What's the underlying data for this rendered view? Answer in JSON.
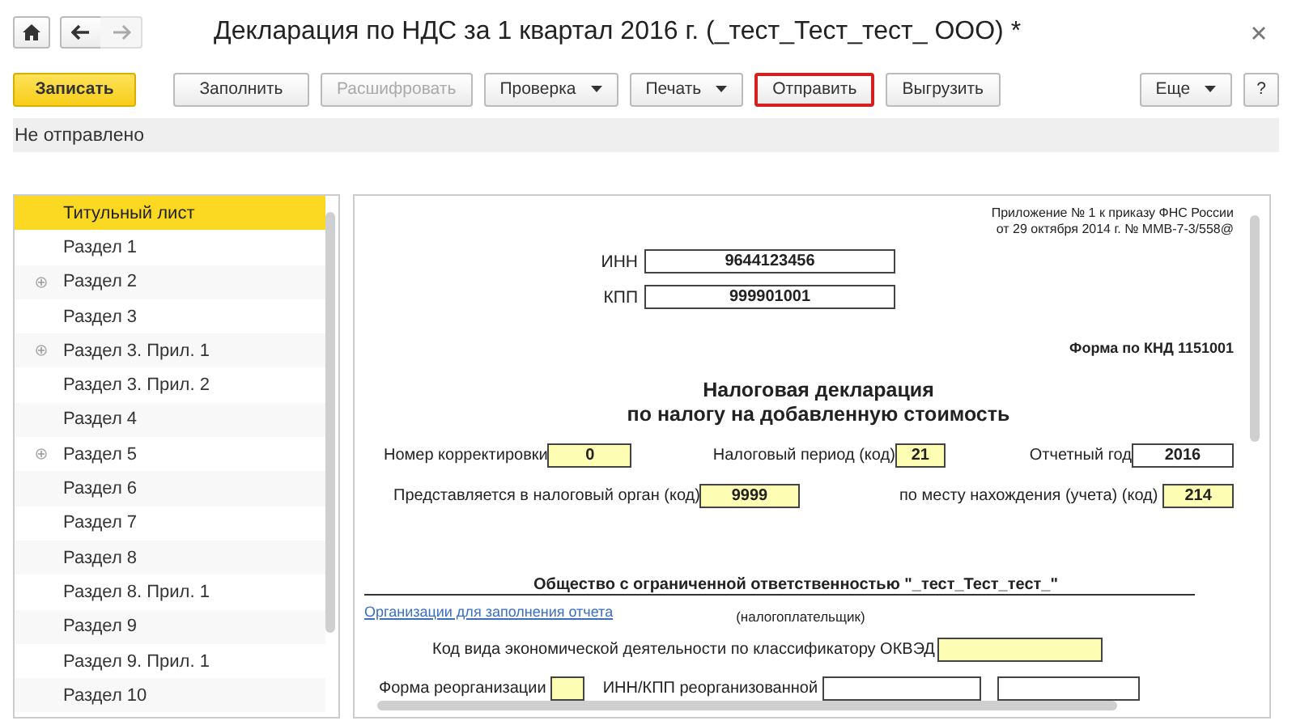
{
  "nav": [
    {
      "kind": "home",
      "disabled": false
    },
    {
      "kind": "back",
      "disabled": false
    },
    {
      "kind": "forward",
      "disabled": true
    }
  ],
  "window": {
    "title": "Декларация по НДС за 1 квартал 2016 г. (_тест_Тест_тест_ ООО) *"
  },
  "toolbar": [
    {
      "label": "Записать",
      "kind": "primary",
      "disabled": false,
      "highlighted": false
    },
    {
      "label": "Заполнить",
      "kind": "plain",
      "disabled": false,
      "highlighted": false
    },
    {
      "label": "Расшифровать",
      "kind": "plain",
      "disabled": true,
      "highlighted": false
    },
    {
      "label": "Проверка",
      "kind": "dropdown",
      "disabled": false,
      "highlighted": false
    },
    {
      "label": "Печать",
      "kind": "dropdown",
      "disabled": false,
      "highlighted": false
    },
    {
      "label": "Отправить",
      "kind": "plain",
      "disabled": false,
      "highlighted": true
    },
    {
      "label": "Выгрузить",
      "kind": "plain",
      "disabled": false,
      "highlighted": false
    }
  ],
  "toolbar_right": [
    {
      "label": "Еще",
      "kind": "dropdown"
    },
    {
      "label": "?",
      "kind": "help"
    }
  ],
  "status": "Не отправлено",
  "sections": [
    {
      "label": "Титульный лист",
      "expandable": false,
      "selected": true
    },
    {
      "label": "Раздел 1",
      "expandable": false,
      "selected": false
    },
    {
      "label": "Раздел 2",
      "expandable": true,
      "selected": false
    },
    {
      "label": "Раздел 3",
      "expandable": false,
      "selected": false
    },
    {
      "label": "Раздел 3. Прил. 1",
      "expandable": true,
      "selected": false
    },
    {
      "label": "Раздел 3. Прил. 2",
      "expandable": false,
      "selected": false
    },
    {
      "label": "Раздел 4",
      "expandable": false,
      "selected": false
    },
    {
      "label": "Раздел 5",
      "expandable": true,
      "selected": false
    },
    {
      "label": "Раздел 6",
      "expandable": false,
      "selected": false
    },
    {
      "label": "Раздел 7",
      "expandable": false,
      "selected": false
    },
    {
      "label": "Раздел 8",
      "expandable": false,
      "selected": false
    },
    {
      "label": "Раздел 8. Прил. 1",
      "expandable": false,
      "selected": false
    },
    {
      "label": "Раздел 9",
      "expandable": false,
      "selected": false
    },
    {
      "label": "Раздел 9. Прил. 1",
      "expandable": false,
      "selected": false
    },
    {
      "label": "Раздел 10",
      "expandable": false,
      "selected": false
    }
  ],
  "document": {
    "appendix": [
      "Приложение № 1 к приказу ФНС России",
      "от 29 октября 2014 г. № ММВ-7-3/558@"
    ],
    "ids": [
      {
        "label": "ИНН",
        "value": "9644123456"
      },
      {
        "label": "КПП",
        "value": "999901001"
      }
    ],
    "form_code": "Форма по КНД 1151001",
    "title": [
      "Налоговая декларация",
      "по налогу на добавленную стоимость"
    ],
    "row_1": [
      {
        "label": "Номер корректировки",
        "value": "0",
        "editable": true
      },
      {
        "label": "Налоговый период (код)",
        "value": "21",
        "editable": true
      },
      {
        "label": "Отчетный год",
        "value": "2016",
        "editable": false
      }
    ],
    "row_2": [
      {
        "label": "Представляется в налоговый орган (код)",
        "value": "9999",
        "editable": true
      },
      {
        "label": "по месту нахождения (учета) (код)",
        "value": "214",
        "editable": true
      }
    ],
    "organization": "Общество с ограниченной ответственностью \"_тест_Тест_тест_\"",
    "organization_link": "Организации для заполнения отчета",
    "organization_note": "(налогоплательщик)",
    "okved": {
      "label": "Код вида экономической деятельности по классификатору ОКВЭД",
      "editable": true
    },
    "reorganization": {
      "label": "Форма реорганизации",
      "editable": true
    },
    "reorganized": {
      "label": "ИНН/КПП реорганизованной",
      "editable": false
    }
  }
}
